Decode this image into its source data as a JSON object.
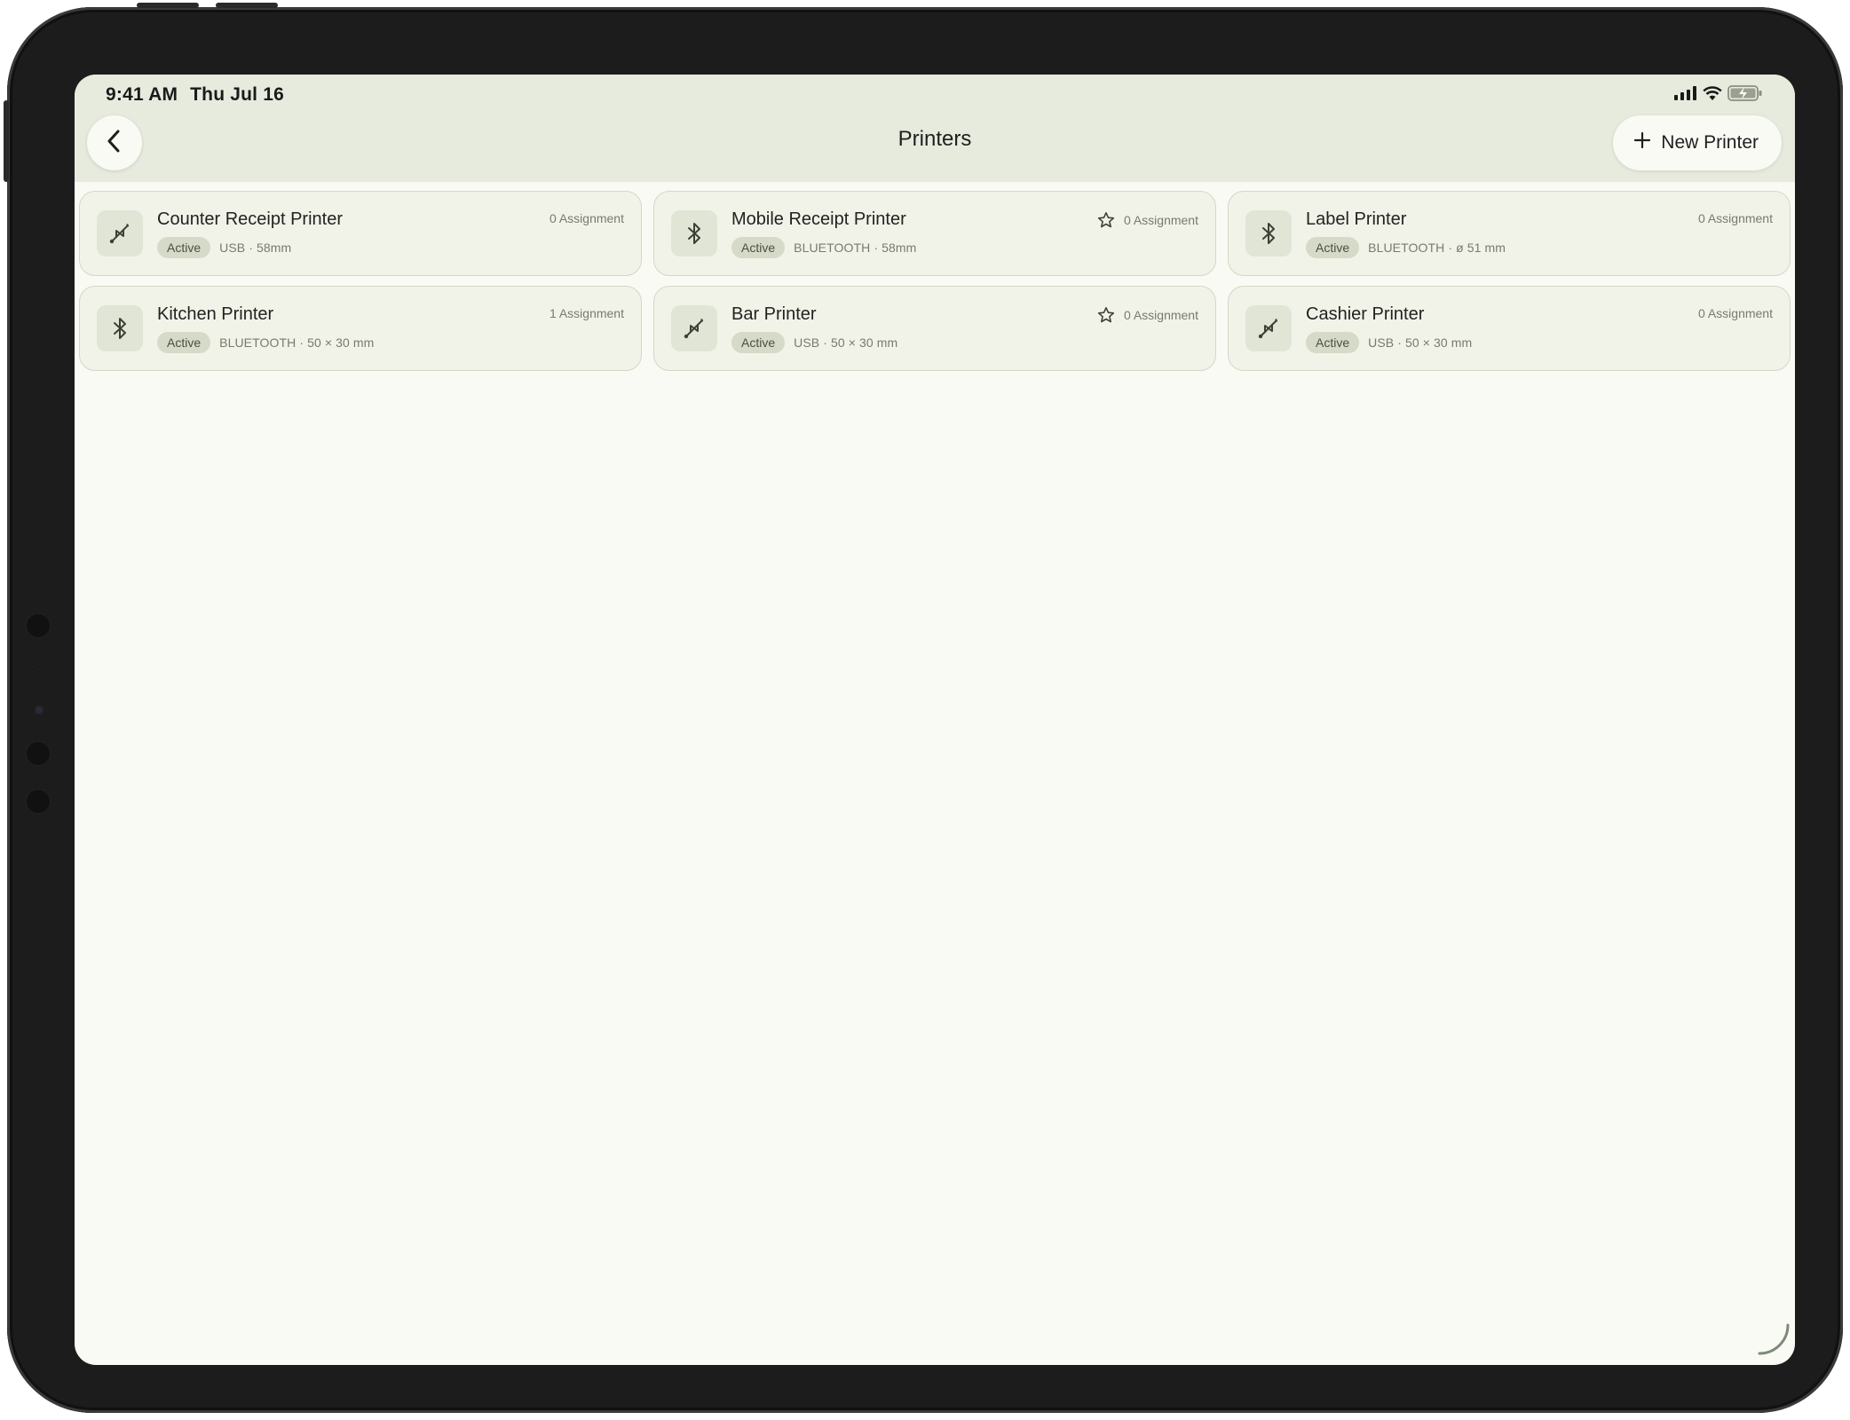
{
  "status_bar": {
    "time": "9:41 AM",
    "date": "Thu Jul 16",
    "icons": [
      "signal-icon",
      "wifi-icon",
      "battery-charging-icon"
    ]
  },
  "header": {
    "back_icon": "chevron-left-icon",
    "title": "Printers",
    "new_button_icon": "plus-icon",
    "new_button_label": "New Printer"
  },
  "printers": [
    {
      "name": "Counter Receipt Printer",
      "status": "Active",
      "spec": "USB · 58mm",
      "assignments": "0 Assignment",
      "connection_icon": "usb-icon",
      "starred": false
    },
    {
      "name": "Mobile Receipt Printer",
      "status": "Active",
      "spec": "BLUETOOTH · 58mm",
      "assignments": "0 Assignment",
      "connection_icon": "bluetooth-icon",
      "starred": true
    },
    {
      "name": "Label Printer",
      "status": "Active",
      "spec": "BLUETOOTH · ø 51 mm",
      "assignments": "0 Assignment",
      "connection_icon": "bluetooth-icon",
      "starred": false
    },
    {
      "name": "Kitchen Printer",
      "status": "Active",
      "spec": "BLUETOOTH · 50 × 30 mm",
      "assignments": "1 Assignment",
      "connection_icon": "bluetooth-icon",
      "starred": false
    },
    {
      "name": "Bar Printer",
      "status": "Active",
      "spec": "USB · 50 × 30 mm",
      "assignments": "0 Assignment",
      "connection_icon": "usb-icon",
      "starred": true
    },
    {
      "name": "Cashier Printer",
      "status": "Active",
      "spec": "USB · 50 × 30 mm",
      "assignments": "0 Assignment",
      "connection_icon": "usb-icon",
      "starred": false
    }
  ],
  "colors": {
    "screen_bg": "#f9faf4",
    "header_bg": "#e6ebde",
    "card_bg": "#f1f3e8",
    "badge_bg": "#d5dbc8"
  }
}
